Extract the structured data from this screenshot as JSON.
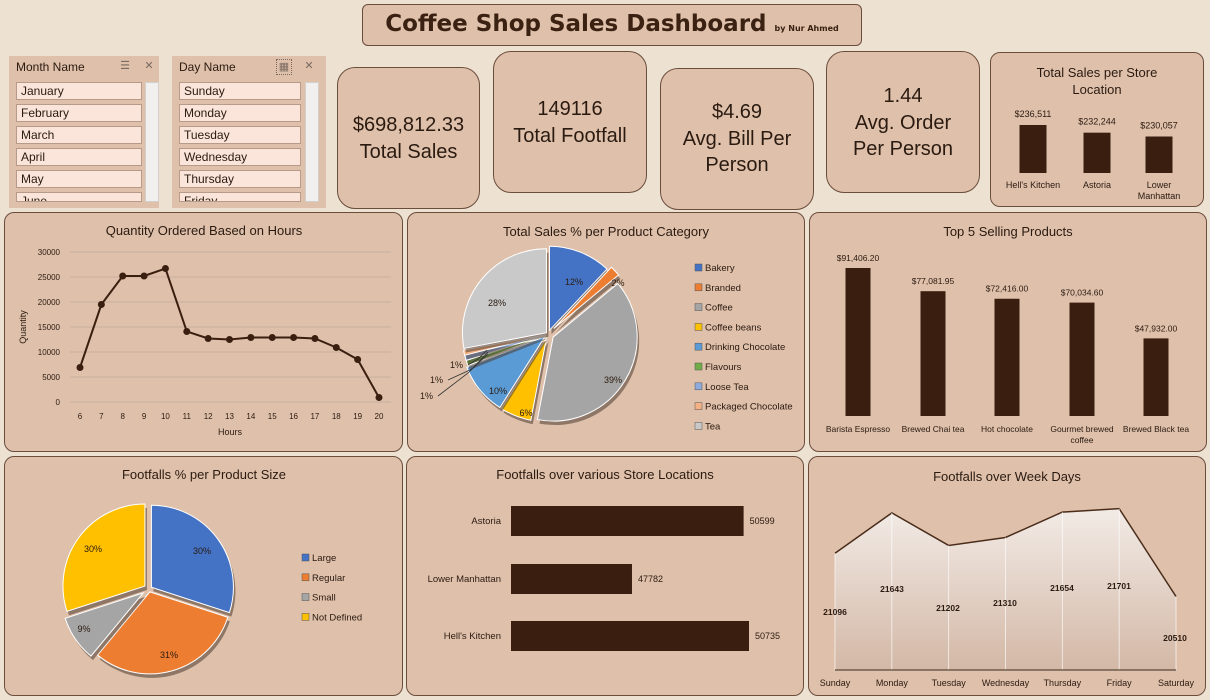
{
  "title": "Coffee Shop Sales Dashboard",
  "author": "by Nur Ahmed",
  "slicers": {
    "month": {
      "header": "Month Name",
      "items": [
        "January",
        "February",
        "March",
        "April",
        "May",
        "June"
      ]
    },
    "day": {
      "header": "Day Name",
      "items": [
        "Sunday",
        "Monday",
        "Tuesday",
        "Wednesday",
        "Thursday",
        "Friday"
      ]
    }
  },
  "kpis": {
    "sales": {
      "value": "$698,812.33",
      "label": "Total Sales"
    },
    "footfall": {
      "value": "149116",
      "label": "Total Footfall"
    },
    "bill": {
      "value": "$4.69",
      "label1": "Avg. Bill Per",
      "label2": "Person"
    },
    "order": {
      "value": "1.44",
      "label1": "Avg. Order",
      "label2": "Per Person"
    }
  },
  "colors": {
    "dark_brown": "#3a1f10",
    "panel": "#dfc1ab",
    "page": "#ede1d2"
  },
  "chart_data": [
    {
      "id": "store_sales",
      "type": "bar",
      "title": "Total Sales per Store Location",
      "categories": [
        "Hell's Kitchen",
        "Astoria",
        "Lower Manhattan"
      ],
      "values": [
        236511,
        232244,
        230057
      ],
      "labels": [
        "$236,511",
        "$232,244",
        "$230,057"
      ],
      "grid": false
    },
    {
      "id": "hours",
      "type": "line",
      "title": "Quantity Ordered Based on Hours",
      "xlabel": "Hours",
      "ylabel": "Quantity",
      "x": [
        6,
        7,
        8,
        9,
        10,
        11,
        12,
        13,
        14,
        15,
        16,
        17,
        18,
        19,
        20
      ],
      "y": [
        6900,
        19500,
        25200,
        25200,
        26700,
        14100,
        12700,
        12500,
        12900,
        12900,
        12900,
        12700,
        10900,
        8500,
        900
      ],
      "ylim": [
        0,
        30000
      ],
      "yticks": [
        0,
        5000,
        10000,
        15000,
        20000,
        25000,
        30000
      ],
      "grid": true
    },
    {
      "id": "category",
      "type": "pie",
      "title": "Total Sales % per Product Category",
      "categories": [
        "Bakery",
        "Branded",
        "Coffee",
        "Coffee beans",
        "Drinking Chocolate",
        "Flavours",
        "Loose Tea",
        "Packaged Chocolate",
        "Tea"
      ],
      "values": [
        12,
        2,
        39,
        6,
        10,
        1,
        1,
        1,
        28
      ],
      "labels": [
        "12%",
        "2%",
        "39%",
        "6%",
        "10%",
        "1%",
        "1%",
        "1%",
        "28%"
      ],
      "colors": [
        "#4472c4",
        "#ed7d31",
        "#a5a5a5",
        "#ffc000",
        "#5b9bd5",
        "#70ad47",
        "#8faadc",
        "#f4b183",
        "#c9c9c9"
      ],
      "legend": "right"
    },
    {
      "id": "top5",
      "type": "bar",
      "title": "Top 5 Selling Products",
      "categories": [
        "Barista Espresso",
        "Brewed Chai tea",
        "Hot chocolate",
        "Gourmet brewed coffee",
        "Brewed Black tea"
      ],
      "values": [
        91406.2,
        77081.95,
        72416.0,
        70034.6,
        47932.0
      ],
      "labels": [
        "$91,406.20",
        "$77,081.95",
        "$72,416.00",
        "$70,034.60",
        "$47,932.00"
      ],
      "grid": false
    },
    {
      "id": "size",
      "type": "pie",
      "title": "Footfalls % per Product Size",
      "categories": [
        "Large",
        "Regular",
        "Small",
        "Not Defined"
      ],
      "values": [
        30,
        31,
        9,
        30
      ],
      "labels": [
        "30%",
        "31%",
        "9%",
        "30%"
      ],
      "colors": [
        "#4472c4",
        "#ed7d31",
        "#a5a5a5",
        "#ffc000"
      ],
      "legend": "right"
    },
    {
      "id": "store_footfall",
      "type": "bar",
      "orientation": "horizontal",
      "title": "Footfalls over various Store Locations",
      "categories": [
        "Astoria",
        "Lower Manhattan",
        "Hell's Kitchen"
      ],
      "values": [
        50599,
        47782,
        50735
      ],
      "labels": [
        "50599",
        "47782",
        "50735"
      ],
      "grid": false
    },
    {
      "id": "weekdays",
      "type": "area",
      "title": "Footfalls over Week Days",
      "categories": [
        "Sunday",
        "Monday",
        "Tuesday",
        "Wednesday",
        "Thursday",
        "Friday",
        "Saturday"
      ],
      "values": [
        21096,
        21643,
        21202,
        21310,
        21654,
        21701,
        20510
      ],
      "labels": [
        "21096",
        "21643",
        "21202",
        "21310",
        "21654",
        "21701",
        "20510"
      ],
      "grid": false
    }
  ]
}
